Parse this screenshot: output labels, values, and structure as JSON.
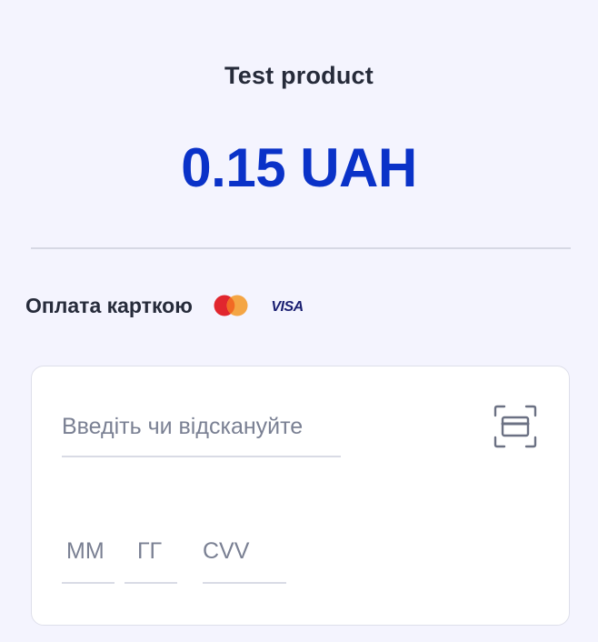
{
  "product": {
    "title": "Test product",
    "price": "0.15 UAH"
  },
  "payment": {
    "label": "Оплата карткою",
    "card_brands": [
      "mastercard",
      "VISA"
    ],
    "visa_text": "VISA"
  },
  "form": {
    "card_number_placeholder": "Введіть чи відскануйте",
    "month_placeholder": "ММ",
    "year_placeholder": "ГГ",
    "cvv_placeholder": "CVV",
    "scan_icon": "scan-card-icon"
  },
  "colors": {
    "background": "#F4F4FE",
    "price": "#0A32C8",
    "text": "#262B3A",
    "placeholder": "#7A8093",
    "mastercard_red": "#EB001B",
    "mastercard_orange": "#F79E1B",
    "visa_navy": "#1A1F71"
  }
}
